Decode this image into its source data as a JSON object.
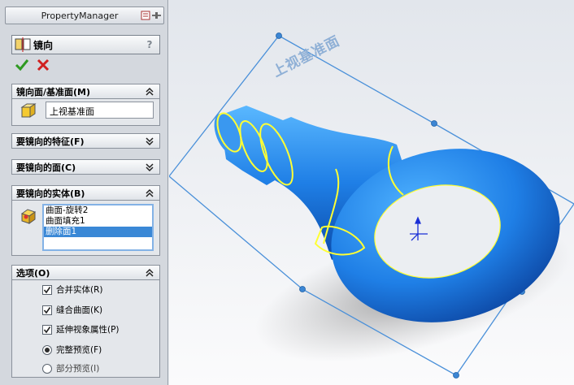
{
  "panel": {
    "title": "PropertyManager",
    "feature_title": "镜向",
    "help": "?"
  },
  "mirror_face": {
    "header": "镜向面/基准面(M)",
    "selection": "上视基准面"
  },
  "features_to_mirror": {
    "header": "要镜向的特征(F)"
  },
  "faces_to_mirror": {
    "header": "要镜向的面(C)"
  },
  "bodies_to_mirror": {
    "header": "要镜向的实体(B)",
    "items": [
      "曲面-旋转2",
      "曲面填充1",
      "删除面1"
    ],
    "selected_index": 2
  },
  "options": {
    "header": "选项(O)",
    "merge_solids": {
      "label": "合并实体(R)",
      "checked": true
    },
    "knit_surfaces": {
      "label": "缝合曲面(K)",
      "checked": true
    },
    "propagate_visual": {
      "label": "延伸视象属性(P)",
      "checked": true
    },
    "full_preview": {
      "label": "完整预览(F)",
      "selected": true
    },
    "partial_preview": {
      "label": "部分预览(I)",
      "selected": false
    }
  },
  "viewport": {
    "plane_label": "上视基准面"
  },
  "colors": {
    "panel_bg": "#d4d8de",
    "part_blue": "#1f7fe6",
    "edge_yellow": "#ffff33",
    "plane_blue": "#4a90d9",
    "selection_highlight": "#3a88d6"
  }
}
